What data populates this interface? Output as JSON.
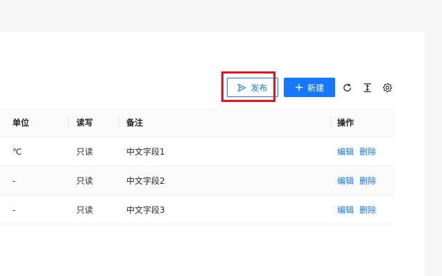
{
  "toolbar": {
    "publish_label": "发布",
    "new_label": "新建",
    "icons": {
      "publish": "send-icon",
      "new": "plus-icon",
      "refresh": "refresh-icon",
      "density": "column-height-icon",
      "settings": "gear-icon"
    }
  },
  "table": {
    "headers": {
      "unit": "单位",
      "rw": "读写",
      "note": "备注",
      "ops": "操作"
    },
    "rows": [
      {
        "unit": "℃",
        "rw": "只读",
        "note": "中文字段1",
        "edit": "编辑",
        "delete": "删除"
      },
      {
        "unit": "-",
        "rw": "只读",
        "note": "中文字段2",
        "edit": "编辑",
        "delete": "删除"
      },
      {
        "unit": "-",
        "rw": "只读",
        "note": "中文字段3",
        "edit": "编辑",
        "delete": "删除"
      }
    ]
  },
  "colors": {
    "primary": "#1677ff",
    "highlight": "#e8101a",
    "header_bg": "#fafafa",
    "border": "#f0f0f0"
  }
}
